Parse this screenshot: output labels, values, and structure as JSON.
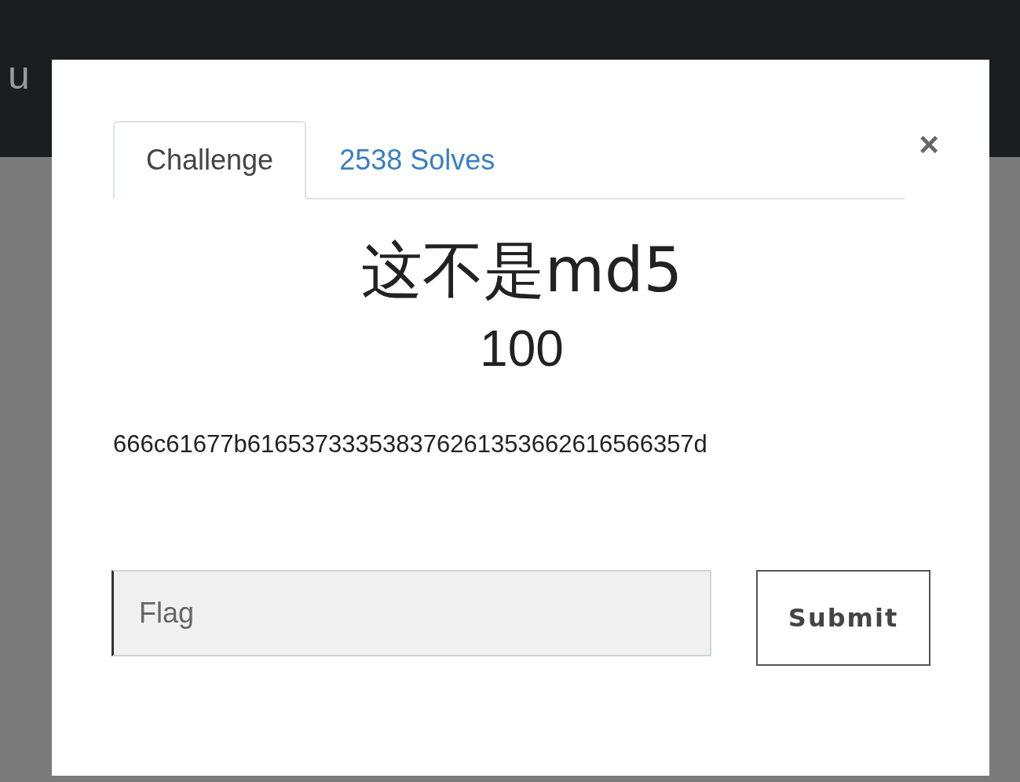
{
  "navbar": {
    "brand": "u"
  },
  "modal": {
    "tabs": [
      {
        "label": "Challenge",
        "selected": true
      },
      {
        "label": "2538 Solves",
        "selected": false
      }
    ],
    "close_button": "×",
    "title": "这不是md5",
    "points": "100",
    "description": "666c61677b616537333538376261353662616566357d",
    "flag_input": {
      "placeholder": "Flag"
    },
    "submit_button": "Submit"
  }
}
